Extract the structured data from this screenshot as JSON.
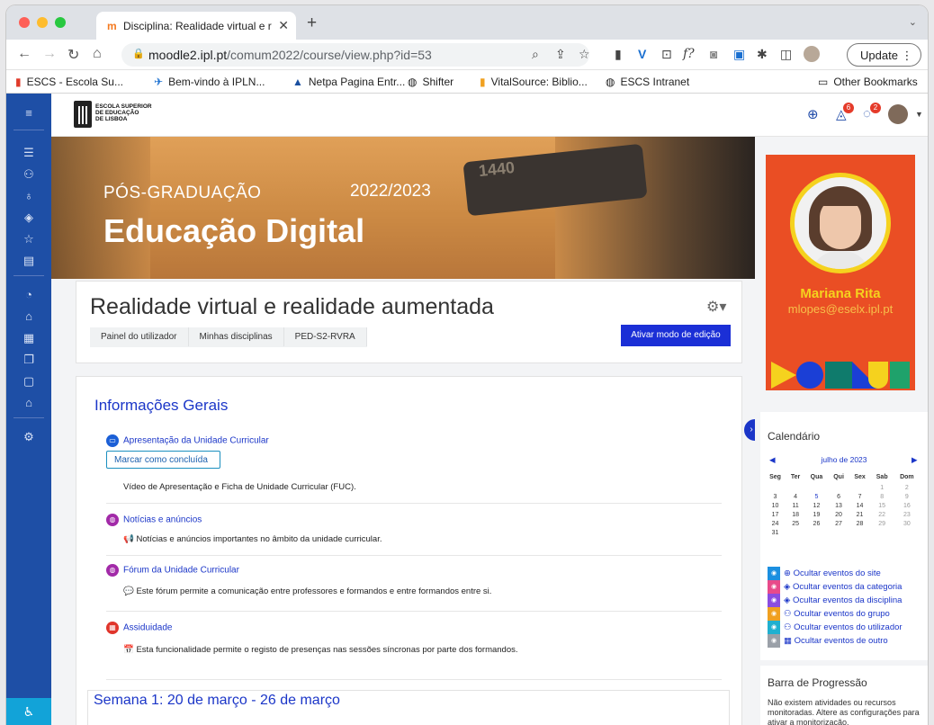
{
  "browser": {
    "tab_title": "Disciplina: Realidade virtual e r",
    "tab_close": "✕",
    "new_tab": "+",
    "url_host": "moodle2.ipl.pt",
    "url_path": "/comum2022/course/view.php?id=53",
    "update_label": "Update",
    "bookmarks": [
      {
        "label": "ESCS - Escola Su..."
      },
      {
        "label": "Bem-vindo à IPLN..."
      },
      {
        "label": "Netpa Pagina Entr..."
      },
      {
        "label": "Shifter"
      },
      {
        "label": "VitalSource: Biblio..."
      },
      {
        "label": "ESCS Intranet"
      }
    ],
    "other_bookmarks": "Other Bookmarks"
  },
  "header": {
    "logo_lines": [
      "ESCOLA SUPERIOR",
      "DE EDUCAÇÃO",
      "DE LISBOA"
    ],
    "notifications_count": "6",
    "messages_count": "2"
  },
  "banner": {
    "subtitle": "PÓS-GRADUAÇÃO",
    "year": "2022/2023",
    "title": "Educação Digital",
    "device_text": "1440"
  },
  "course": {
    "title": "Realidade virtual e realidade aumentada",
    "breadcrumbs": [
      "Painel do utilizador",
      "Minhas disciplinas",
      "PED-S2-RVRA"
    ],
    "edit_button": "Ativar modo de edição"
  },
  "section": {
    "title": "Informações Gerais",
    "mark_done": "Marcar como concluída",
    "activities": [
      {
        "name": "Apresentação da Unidade Curricular",
        "desc": "Vídeo de Apresentação e Ficha de Unidade Curricular (FUC).",
        "color": "#1b5fd6",
        "icon": "▭"
      },
      {
        "name": "Notícias e anúncios",
        "desc": "📢 Notícias e anúncios importantes no âmbito da unidade curricular.",
        "color": "#a22aa8",
        "icon": "◍"
      },
      {
        "name": "Fórum da Unidade Curricular",
        "desc": "💬 Este fórum permite a comunicação entre professores e formandos e entre formandos entre si.",
        "color": "#a22aa8",
        "icon": "◍"
      },
      {
        "name": "Assiduidade",
        "desc": "📅 Esta funcionalidade permite o registo de presenças nas sessões síncronas por parte dos formandos.",
        "color": "#e0352b",
        "icon": "▦"
      }
    ],
    "week_title": "Semana 1: 20 de março - 26 de março"
  },
  "profile": {
    "name": "Mariana Rita",
    "email": "mlopes@eselx.ipl.pt"
  },
  "calendar": {
    "title": "Calendário",
    "month": "julho de 2023",
    "days": [
      "Seg",
      "Ter",
      "Qua",
      "Qui",
      "Sex",
      "Sab",
      "Dom"
    ],
    "weeks": [
      [
        "",
        "",
        "",
        "",
        "",
        "1",
        "2"
      ],
      [
        "3",
        "4",
        "5",
        "6",
        "7",
        "8",
        "9"
      ],
      [
        "10",
        "11",
        "12",
        "13",
        "14",
        "15",
        "16"
      ],
      [
        "17",
        "18",
        "19",
        "20",
        "21",
        "22",
        "23"
      ],
      [
        "24",
        "25",
        "26",
        "27",
        "28",
        "29",
        "30"
      ],
      [
        "31",
        "",
        "",
        "",
        "",
        "",
        ""
      ]
    ],
    "events": [
      {
        "label": "Ocultar eventos do site",
        "color": "#1b8fe0",
        "icon": "🌐"
      },
      {
        "label": "Ocultar eventos da categoria",
        "color": "#e84a8a",
        "icon": "◈"
      },
      {
        "label": "Ocultar eventos da disciplina",
        "color": "#8a4de0",
        "icon": "◈"
      },
      {
        "label": "Ocultar eventos do grupo",
        "color": "#f0a020",
        "icon": "⚇"
      },
      {
        "label": "Ocultar eventos do utilizador",
        "color": "#20b0d0",
        "icon": "⚇"
      },
      {
        "label": "Ocultar eventos de outro",
        "color": "#9aa0a8",
        "icon": "▦"
      }
    ]
  },
  "progress_block": {
    "title": "Barra de Progressão",
    "text": "Não existem atividades ou recursos monitoradas. Altere as configurações para ativar a monitorização."
  }
}
